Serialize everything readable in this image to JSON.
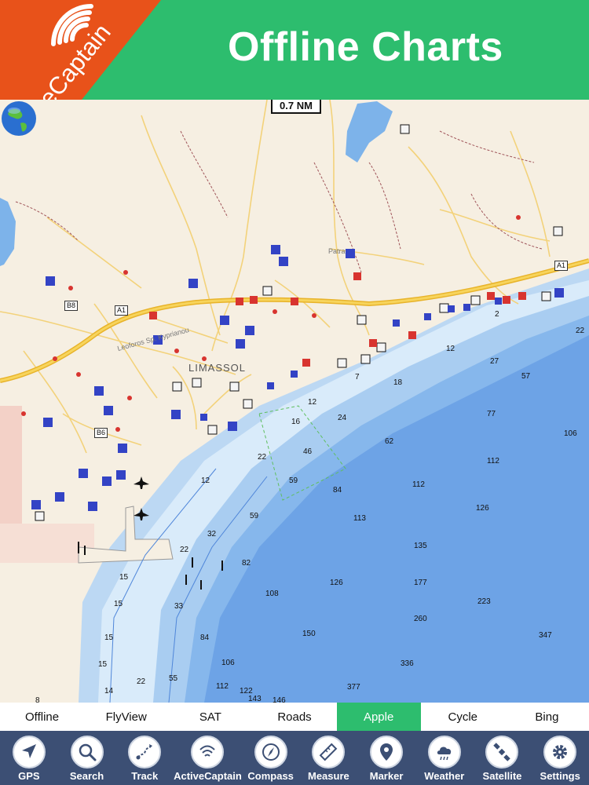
{
  "header": {
    "title": "Offline Charts",
    "badge_text": "ActiveCaptain",
    "colors": {
      "header_bg": "#2dbd6e",
      "badge_bg": "#e8521a"
    }
  },
  "map": {
    "scale": "0.7 NM",
    "city": "LIMASSOL",
    "roads": [
      "A1",
      "A1",
      "B8",
      "B6"
    ],
    "places": [
      "Patra",
      "Leoforos Sp. Kyprianou"
    ],
    "depths": [
      "22",
      "27",
      "57",
      "77",
      "106",
      "112",
      "112",
      "126",
      "113",
      "135",
      "177",
      "223",
      "260",
      "347",
      "336",
      "377",
      "150",
      "106",
      "108",
      "126",
      "84",
      "59",
      "59",
      "46",
      "62",
      "24",
      "18",
      "12",
      "16",
      "22",
      "12",
      "32",
      "82",
      "22",
      "33",
      "84",
      "55",
      "112",
      "122",
      "143",
      "146",
      "15",
      "15",
      "15",
      "15",
      "14",
      "22",
      "8",
      "7",
      "2",
      "12"
    ],
    "globe_icon": "globe-icon"
  },
  "tabs": [
    {
      "label": "Offline",
      "active": false
    },
    {
      "label": "FlyView",
      "active": false
    },
    {
      "label": "SAT",
      "active": false
    },
    {
      "label": "Roads",
      "active": false
    },
    {
      "label": "Apple",
      "active": true
    },
    {
      "label": "Cycle",
      "active": false
    },
    {
      "label": "Bing",
      "active": false
    }
  ],
  "toolbar": [
    {
      "label": "GPS",
      "icon": "gps-arrow-icon"
    },
    {
      "label": "Search",
      "icon": "search-icon"
    },
    {
      "label": "Track",
      "icon": "track-icon"
    },
    {
      "label": "ActiveCaptain",
      "icon": "activecaptain-icon"
    },
    {
      "label": "Compass",
      "icon": "compass-icon"
    },
    {
      "label": "Measure",
      "icon": "ruler-icon"
    },
    {
      "label": "Marker",
      "icon": "marker-pin-icon"
    },
    {
      "label": "Weather",
      "icon": "weather-cloud-icon"
    },
    {
      "label": "Satellite",
      "icon": "satellite-icon"
    },
    {
      "label": "Settings",
      "icon": "gear-icon"
    }
  ]
}
